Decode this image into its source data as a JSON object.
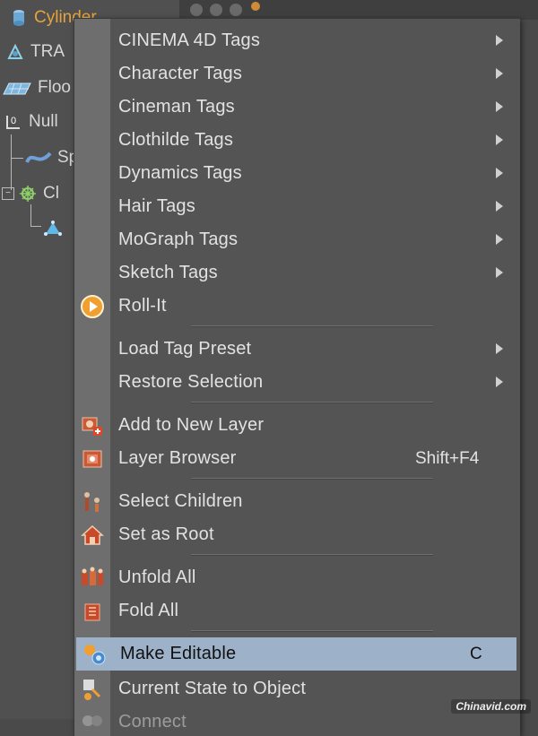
{
  "tree": {
    "rows": [
      {
        "label": "Cylinder",
        "icon": "cylinder-icon"
      },
      {
        "label": "TRA",
        "icon": "transform-icon"
      },
      {
        "label": "Floo",
        "icon": "floor-icon"
      },
      {
        "label": "Null",
        "icon": "null-icon"
      },
      {
        "label": "Sp",
        "icon": "spline-icon"
      },
      {
        "label": "Cl",
        "icon": "cloner-icon"
      },
      {
        "label": "",
        "icon": "triangle-icon"
      }
    ]
  },
  "menu": {
    "items": [
      {
        "label": "CINEMA 4D Tags",
        "submenu": true
      },
      {
        "label": "Character Tags",
        "submenu": true
      },
      {
        "label": "Cineman Tags",
        "submenu": true
      },
      {
        "label": "Clothilde Tags",
        "submenu": true
      },
      {
        "label": "Dynamics Tags",
        "submenu": true
      },
      {
        "label": "Hair Tags",
        "submenu": true
      },
      {
        "label": "MoGraph Tags",
        "submenu": true
      },
      {
        "label": "Sketch Tags",
        "submenu": true
      },
      {
        "label": "Roll-It",
        "icon": "roll-it-icon"
      },
      {
        "label": "Load Tag Preset",
        "submenu": true
      },
      {
        "label": "Restore Selection",
        "submenu": true
      },
      {
        "label": "Add to New Layer",
        "icon": "add-layer-icon"
      },
      {
        "label": "Layer Browser",
        "icon": "layer-browser-icon",
        "shortcut": "Shift+F4"
      },
      {
        "label": "Select Children",
        "icon": "select-children-icon"
      },
      {
        "label": "Set as Root",
        "icon": "set-root-icon"
      },
      {
        "label": "Unfold All",
        "icon": "unfold-icon"
      },
      {
        "label": "Fold All",
        "icon": "fold-icon"
      },
      {
        "label": "Make Editable",
        "icon": "make-editable-icon",
        "shortcut": "C",
        "highlighted": true
      },
      {
        "label": "Current State to Object",
        "icon": "current-state-icon"
      },
      {
        "label": "Connect",
        "icon": "connect-icon"
      }
    ]
  },
  "colors": {
    "highlight": "#9db1c9",
    "menu_bg": "#545454",
    "gutter": "#6e6e6e",
    "selected_object": "#e8a33a"
  },
  "watermark": "Chinavid.com"
}
